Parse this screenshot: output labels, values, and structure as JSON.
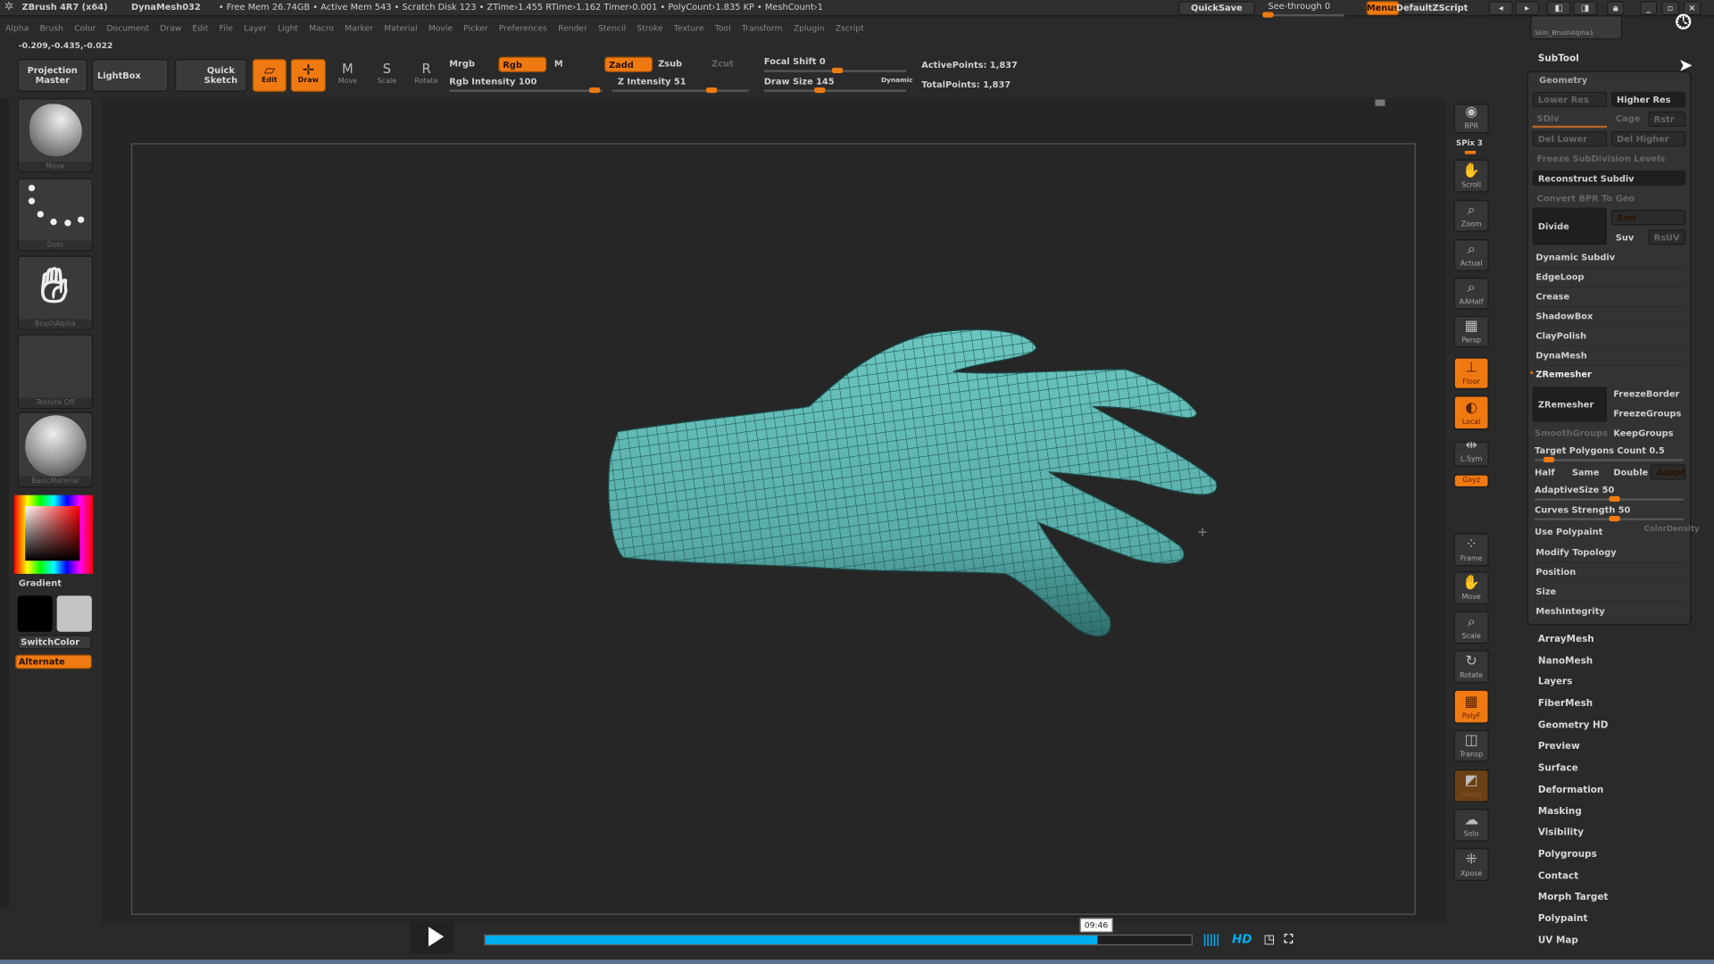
{
  "titlebar": {
    "app": "ZBrush 4R7 (x64)",
    "document": "DynaMesh032",
    "stats": "• Free Mem 26.74GB • Active Mem 543 • Scratch Disk 123 • ZTime›1.455 RTime›1.162 Timer›0.001 • PolyCount›1.835 KP • MeshCount›1",
    "quicksave": "QuickSave",
    "seethrough": "See-through  0",
    "menus": "Menus",
    "defaultzscript": "DefaultZScript"
  },
  "menubar": [
    "Alpha",
    "Brush",
    "Color",
    "Document",
    "Draw",
    "Edit",
    "File",
    "Layer",
    "Light",
    "Macro",
    "Marker",
    "Material",
    "Movie",
    "Picker",
    "Preferences",
    "Render",
    "Stencil",
    "Stroke",
    "Texture",
    "Tool",
    "Transform",
    "Zplugin",
    "Zscript"
  ],
  "coords": "-0.209,-0.435,-0.022",
  "toolbar": {
    "projection_master": "Projection Master",
    "lightbox": "LightBox",
    "quick_sketch": "Quick Sketch",
    "edit": "Edit",
    "draw": "Draw",
    "move": "Move",
    "scale": "Scale",
    "rotate": "Rotate",
    "mrgb": "Mrgb",
    "rgb": "Rgb",
    "m": "M",
    "zadd": "Zadd",
    "zsub": "Zsub",
    "zcut": "Zcut",
    "rgb_intensity": "Rgb Intensity 100",
    "z_intensity": "Z Intensity 51",
    "focal_shift": "Focal Shift 0",
    "draw_size": "Draw Size 145",
    "dynamic": "Dynamic",
    "active_points": "ActivePoints: 1,837",
    "total_points": "TotalPoints: 1,837"
  },
  "slider_values": {
    "rgb_intensity": 100,
    "z_intensity": 51,
    "focal_shift": 0,
    "draw_size": 145
  },
  "leftshelf": {
    "brush": "Move",
    "stroke": "Dots",
    "alpha": "BrushAlpha",
    "texture": "Texture Off",
    "material": "BasicMaterial",
    "gradient": "Gradient",
    "switchcolor": "SwitchColor",
    "alternate": "Alternate"
  },
  "righttools": [
    "BPR",
    "SPix 3",
    "Scroll",
    "Zoom",
    "Actual",
    "AAHalf",
    "Persp",
    "Floor",
    "Local",
    "L.Sym",
    "Gxyz",
    "Frame",
    "Move",
    "Scale",
    "Rotate",
    "PolyF",
    "Transp",
    "Ghost",
    "Solo",
    "Xpose"
  ],
  "rightpanel": {
    "brush_alpha": "Skin_BrushAlpha1",
    "subtool": "SubTool",
    "geometry": "Geometry",
    "lower_res": "Lower Res",
    "higher_res": "Higher Res",
    "sdiv": "SDiv",
    "cage": "Cage",
    "rstr": "Rstr",
    "del_lower": "Del Lower",
    "del_higher": "Del Higher",
    "freeze_subdiv": "Freeze SubDivision Levels",
    "reconstruct": "Reconstruct Subdiv",
    "convert_bpr": "Convert BPR To Geo",
    "divide": "Divide",
    "smt": "Smt",
    "suv": "Suv",
    "rsuv": "RsUV",
    "sections": [
      "Dynamic Subdiv",
      "EdgeLoop",
      "Crease",
      "ShadowBox",
      "ClayPolish",
      "DynaMesh"
    ],
    "zremesher": "ZRemesher",
    "zremesher_btn": "ZRemesher",
    "freezeborder": "FreezeBorder",
    "freezegroups": "FreezeGroups",
    "smoothgroups": "SmoothGroups",
    "keepgroups": "KeepGroups",
    "target_polys": "Target Polygons Count 0.5",
    "half": "Half",
    "same": "Same",
    "double": "Double",
    "adapt": "Adapt",
    "adaptive_size": "AdaptiveSize 50",
    "curves_strength": "Curves Strength 50",
    "use_polypaint": "Use Polypaint",
    "color_density": "ColorDensity",
    "sections2": [
      "Modify Topology",
      "Position",
      "Size",
      "MeshIntegrity"
    ],
    "lower": [
      "ArrayMesh",
      "NanoMesh",
      "Layers",
      "FiberMesh",
      "Geometry HD",
      "Preview",
      "Surface",
      "Deformation",
      "Masking",
      "Visibility",
      "Polygroups",
      "Contact",
      "Morph Target",
      "Polypaint",
      "UV Map"
    ]
  },
  "player": {
    "time": "09:46",
    "progress_percent": 86.7,
    "hd": "HD"
  },
  "colors": {
    "accent": "#f07a12",
    "mesh": "#5db3ae",
    "progress": "#00aeef"
  }
}
